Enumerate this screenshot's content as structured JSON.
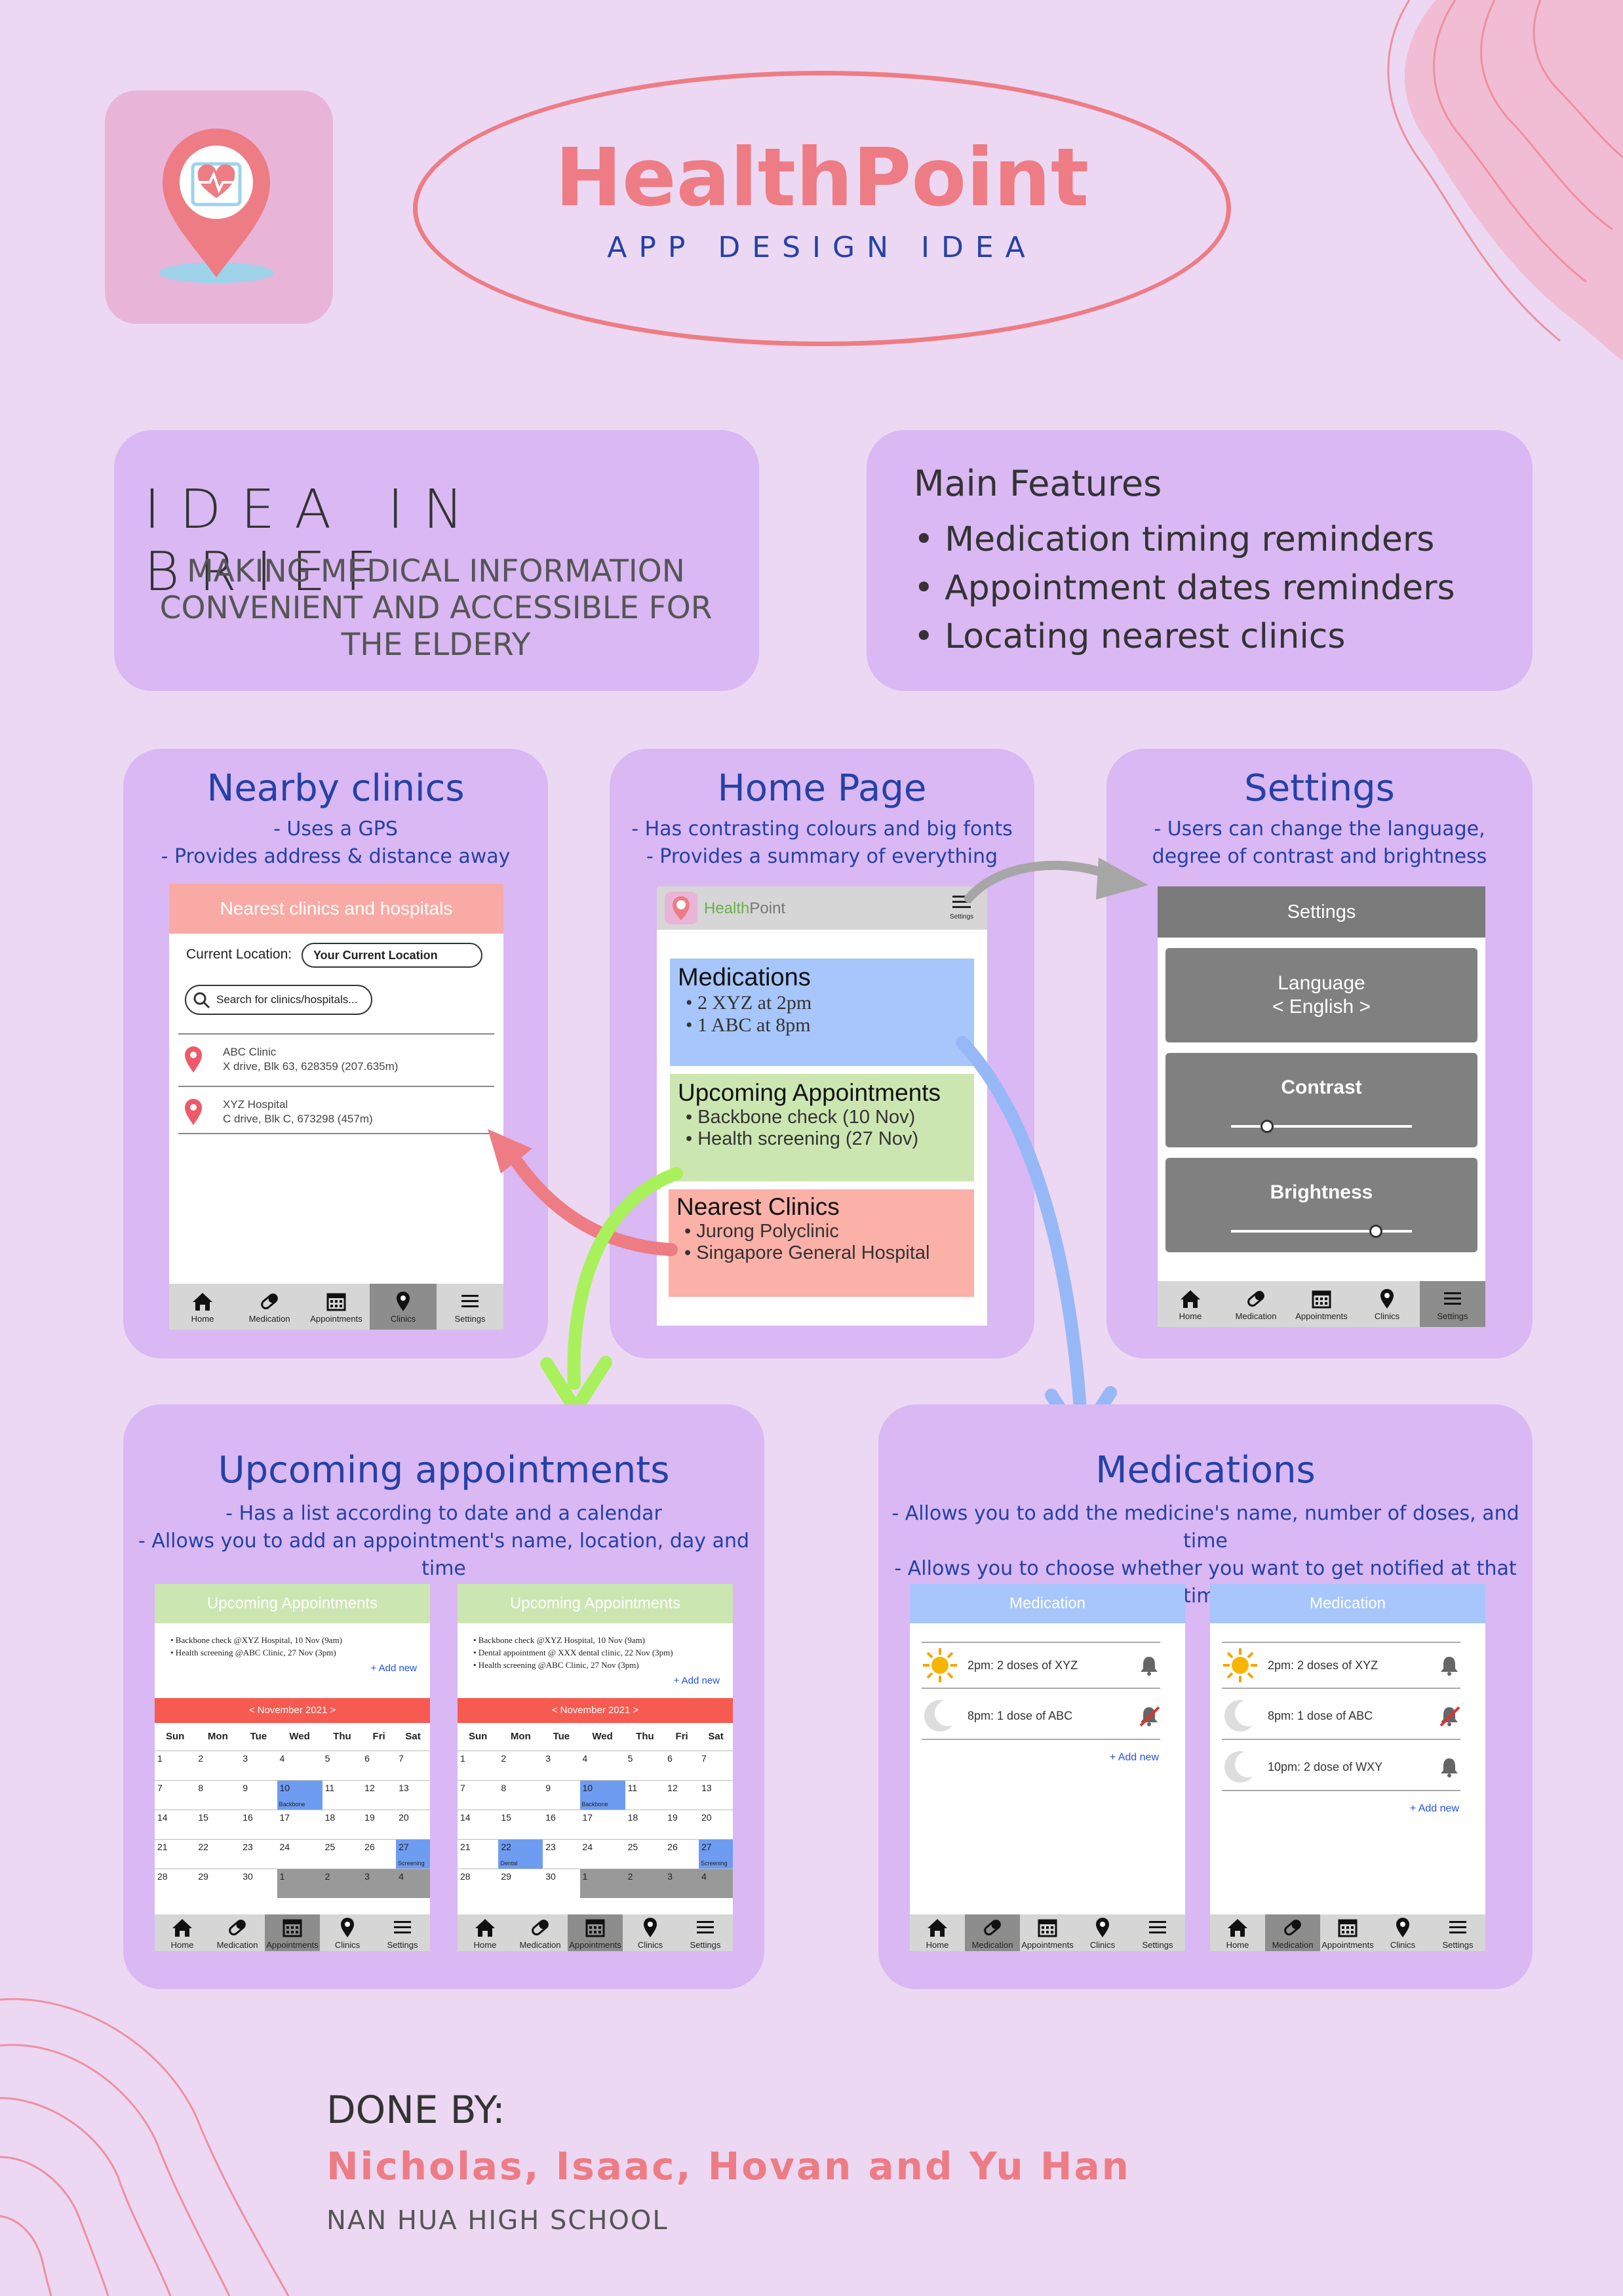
{
  "header": {
    "title": "HealthPoint",
    "subtitle": "APP DESIGN IDEA"
  },
  "brief": {
    "title": "IDEA IN BRIEF",
    "text": "MAKING MEDICAL INFORMATION CONVENIENT AND ACCESSIBLE FOR THE ELDERY"
  },
  "features": {
    "title": "Main Features",
    "items": [
      "Medication timing reminders",
      "Appointment dates reminders",
      "Locating nearest clinics"
    ]
  },
  "nav": [
    "Home",
    "Medication",
    "Appointments",
    "Clinics",
    "Settings"
  ],
  "nearby": {
    "title": "Nearby clinics",
    "desc": [
      "- Uses a GPS",
      "- Provides address & distance away"
    ],
    "phone": {
      "header": "Nearest clinics and hospitals",
      "location_label": "Current Location:",
      "location_value": "Your Current Location",
      "search_placeholder": "Search for clinics/hospitals...",
      "clinics": [
        {
          "name": "ABC Clinic",
          "address": "X drive, Blk 63, 628359 (207.635m)"
        },
        {
          "name": "XYZ Hospital",
          "address": "C drive, Blk C, 673298 (457m)"
        }
      ]
    }
  },
  "home": {
    "title": "Home Page",
    "desc": [
      "- Has contrasting colours and big fonts",
      "- Provides a summary of everything"
    ],
    "phone": {
      "brand_a": "Health",
      "brand_b": "Point",
      "settings": "Settings",
      "medications": {
        "title": "Medications",
        "items": [
          "2 XYZ at 2pm",
          "1 ABC at 8pm"
        ]
      },
      "appointments": {
        "title": "Upcoming Appointments",
        "items": [
          "Backbone check (10 Nov)",
          "Health screening (27 Nov)"
        ]
      },
      "clinics": {
        "title": "Nearest Clinics",
        "items": [
          "Jurong Polyclinic",
          "Singapore General Hospital"
        ]
      }
    }
  },
  "settings": {
    "title": "Settings",
    "desc": [
      "- Users can change the language,",
      "degree of contrast and brightness"
    ],
    "phone": {
      "header": "Settings",
      "language": "Language",
      "language_value": "< English >",
      "contrast": "Contrast",
      "brightness": "Brightness",
      "contrast_level": 0.2,
      "brightness_level": 0.8
    }
  },
  "appointments": {
    "title": "Upcoming appointments",
    "desc": [
      "- Has a list according to date and a calendar",
      "- Allows you to add an appointment's name, location, day and time"
    ],
    "header": "Upcoming Appointments",
    "add_new": "+ Add new",
    "month": "< November 2021 >",
    "days": [
      "Sun",
      "Mon",
      "Tue",
      "Wed",
      "Thu",
      "Fri",
      "Sat"
    ],
    "phone1": {
      "items": [
        "Backbone check @XYZ Hospital, 10 Nov (9am)",
        "Health screening @ABC Clinic, 27 Nov (3pm)"
      ],
      "tag22": "",
      "tag10": "Backbone",
      "tag27": "Screening"
    },
    "phone2": {
      "items": [
        "Backbone check @XYZ Hospital, 10 Nov (9am)",
        "Dental appointment @ XXX dental clinic, 22 Nov (3pm)",
        "Health screening @ABC Clinic, 27 Nov (3pm)"
      ],
      "tag22": "Dental",
      "tag10": "Backbone",
      "tag27": "Screening"
    }
  },
  "medications": {
    "title": "Medications",
    "desc": [
      "- Allows you to add the medicine's name, number of doses, and time",
      "- Allows you to choose whether you want to get notified at that time"
    ],
    "header": "Medication",
    "add_new": "+ Add new",
    "phone1": [
      "2pm: 2 doses of XYZ",
      "8pm: 1 dose of ABC"
    ],
    "phone2": [
      "2pm: 2 doses of XYZ",
      "8pm: 1 dose of ABC",
      "10pm: 2 dose of WXY"
    ]
  },
  "credits": {
    "label": "DONE BY:",
    "names": "Nicholas, Isaac, Hovan and Yu Han",
    "school": "NAN HUA HIGH SCHOOL"
  },
  "colors": {
    "background": "#ecd8f3",
    "card": "#d9b8f3",
    "accent": "#ee7c84",
    "blue": "#2541a6"
  }
}
